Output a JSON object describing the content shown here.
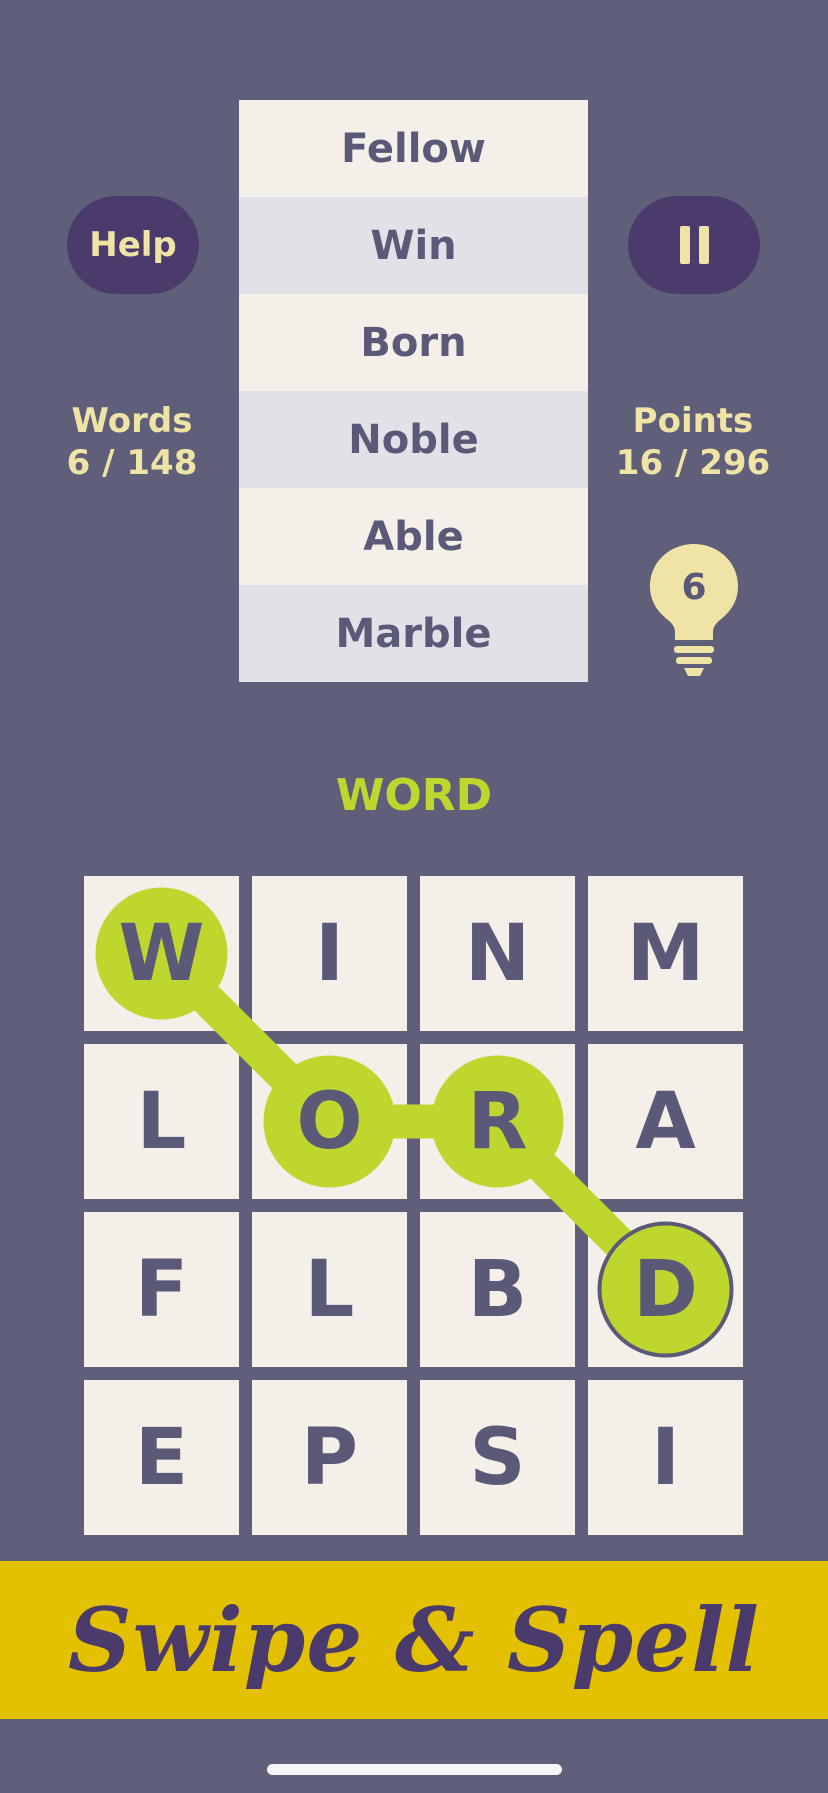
{
  "header": {
    "help_label": "Help"
  },
  "found_words": [
    "Fellow",
    "Win",
    "Born",
    "Noble",
    "Able",
    "Marble"
  ],
  "stats": {
    "words_label": "Words",
    "words_value": "6 / 148",
    "points_label": "Points",
    "points_value": "16 / 296"
  },
  "hint": {
    "count": "6"
  },
  "current_word": "WORD",
  "board": {
    "rows": [
      [
        "W",
        "I",
        "N",
        "M"
      ],
      [
        "L",
        "O",
        "R",
        "A"
      ],
      [
        "F",
        "L",
        "B",
        "D"
      ],
      [
        "E",
        "P",
        "S",
        "I"
      ]
    ],
    "selected_path": [
      [
        0,
        0
      ],
      [
        1,
        1
      ],
      [
        1,
        2
      ],
      [
        2,
        3
      ]
    ]
  },
  "banner": {
    "title": "Swipe & Spell"
  },
  "colors": {
    "background": "#5f5f7a",
    "button": "#4a3b6c",
    "accent_text": "#efe3a5",
    "selection": "#bfd62f",
    "tile": "#f4efe8",
    "banner": "#e3c000"
  }
}
